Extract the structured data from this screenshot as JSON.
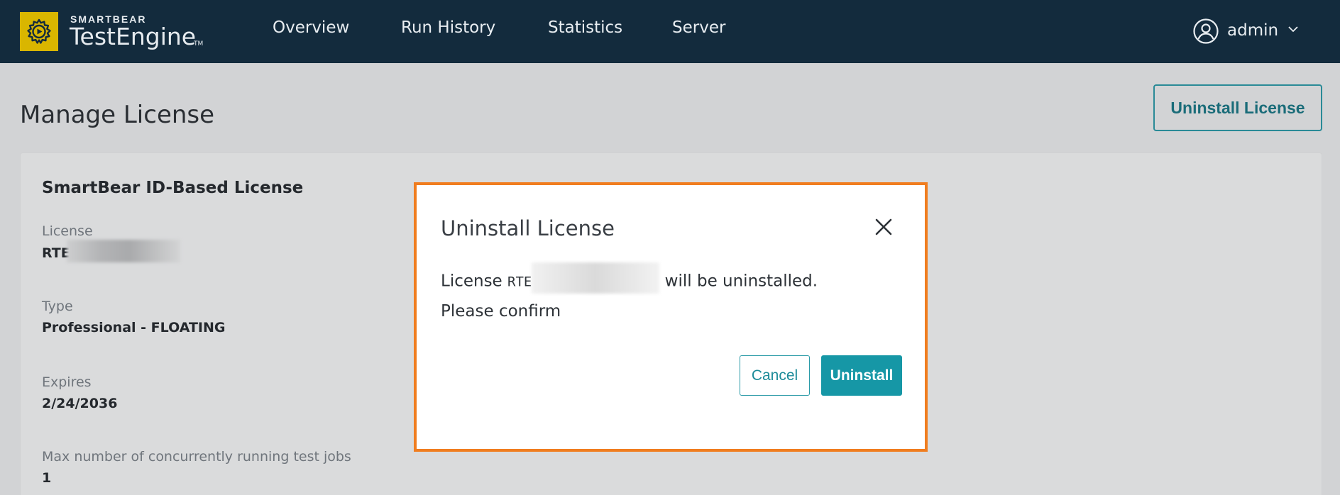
{
  "header": {
    "brand_small": "SMARTBEAR",
    "brand_name": "TestEngine",
    "brand_tm": "TM",
    "nav": [
      {
        "label": "Overview"
      },
      {
        "label": "Run History"
      },
      {
        "label": "Statistics"
      },
      {
        "label": "Server"
      }
    ],
    "user": {
      "name": "admin",
      "icon": "user-circle-icon"
    }
  },
  "page": {
    "title": "Manage License",
    "uninstall_button": "Uninstall License"
  },
  "license_card": {
    "title": "SmartBear ID-Based License",
    "fields": [
      {
        "label": "License",
        "value": "RTE"
      },
      {
        "label": "Type",
        "value": "Professional - FLOATING"
      },
      {
        "label": "Expires",
        "value": "2/24/2036"
      },
      {
        "label": "Max number of concurrently running test jobs",
        "value": "1"
      }
    ]
  },
  "modal": {
    "title": "Uninstall License",
    "text_prefix": "License",
    "license_code": "RTE",
    "text_suffix": "will be uninstalled.",
    "confirm_text": "Please confirm",
    "cancel_label": "Cancel",
    "uninstall_label": "Uninstall"
  },
  "colors": {
    "nav_bg": "#132b3d",
    "logo": "#d9b600",
    "accent": "#1697a6",
    "highlight_border": "#f07d1f"
  }
}
